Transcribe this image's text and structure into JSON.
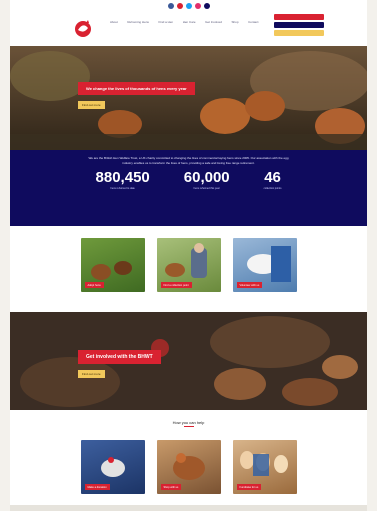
{
  "header": {
    "nav": [
      "About",
      "Rehoming Hens",
      "Find a Hen",
      "Hen Care",
      "Get Involved",
      "Shop",
      "Contact"
    ],
    "social_colors": [
      "#3b5998",
      "#d92231",
      "#1da1f2",
      "#e1306c",
      "#0f0b5e"
    ]
  },
  "hero1": {
    "title": "We change the lives of thousands of hens every year",
    "button": "Find out more"
  },
  "stats": {
    "intro": "We are the British Hen Welfare Trust, a UK charity committed to changing the lives of commercial laying hens since 2005. Our association with the egg industry enables us to transform the lives of hens, providing a safe and loving free range retirement.",
    "items": [
      {
        "value": "880,450",
        "label": "hens rehomed to date"
      },
      {
        "value": "60,000",
        "label": "hens rehomed this year"
      },
      {
        "value": "46",
        "label": "collection points"
      }
    ]
  },
  "cards_row1": [
    {
      "caption": "Adopt hens"
    },
    {
      "caption": "Find a collection point"
    },
    {
      "caption": "Volunteer with us"
    }
  ],
  "hero2": {
    "title": "Get involved with the BHWT",
    "button": "Find out more"
  },
  "section2": {
    "title": "How you can help"
  },
  "cards_row2": [
    {
      "caption": "Make a donation"
    },
    {
      "caption": "Shop with us"
    },
    {
      "caption": "Fundraise for us"
    }
  ]
}
